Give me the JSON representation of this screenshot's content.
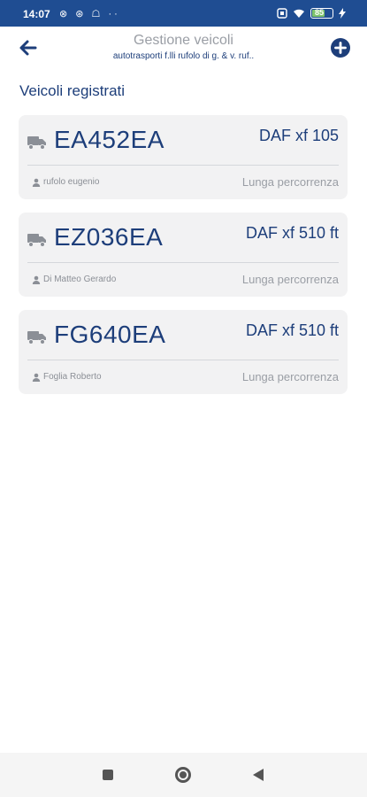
{
  "status_bar": {
    "time": "14:07",
    "left_icons": "⊗ ⊛ ☖ ··",
    "battery_level": "85",
    "battery_color": "#7ec46b"
  },
  "header": {
    "title": "Gestione veicoli",
    "subtitle": "autotrasporti f.lli rufolo di g. & v. ruf..",
    "back_icon": "arrow-left-icon",
    "add_icon": "plus-circle-icon"
  },
  "section": {
    "title": "Veicoli registrati"
  },
  "vehicles": [
    {
      "plate": "EA452EA",
      "model": "DAF xf 105",
      "driver": "rufolo eugenio",
      "usage": "Lunga percorrenza"
    },
    {
      "plate": "EZ036EA",
      "model": "DAF xf 510 ft",
      "driver": "Di Matteo Gerardo",
      "usage": "Lunga percorrenza"
    },
    {
      "plate": "FG640EA",
      "model": "DAF xf 510 ft",
      "driver": "Foglia Roberto",
      "usage": "Lunga percorrenza"
    }
  ],
  "colors": {
    "primary": "#1d3e7a",
    "status_bar": "#1f4d92",
    "card_bg": "#f2f2f3",
    "muted_text": "#9a9ea5"
  }
}
